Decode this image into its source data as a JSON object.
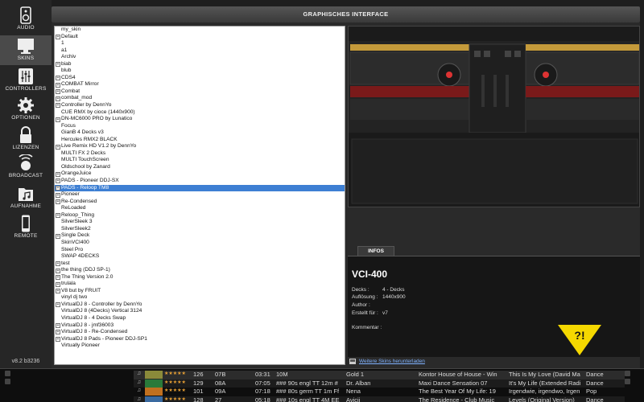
{
  "window": {
    "title": "GRAPHISCHES INTERFACE",
    "version": "v8.2 b3236"
  },
  "nav": [
    {
      "id": "audio",
      "label": "AUDIO",
      "icon": "speaker-icon"
    },
    {
      "id": "skins",
      "label": "SKINS",
      "icon": "monitor-icon",
      "active": true
    },
    {
      "id": "controllers",
      "label": "CONTROLLERS",
      "icon": "sliders-icon"
    },
    {
      "id": "optionen",
      "label": "OPTIONEN",
      "icon": "gear-icon"
    },
    {
      "id": "lizenzen",
      "label": "LIZENZEN",
      "icon": "lock-icon"
    },
    {
      "id": "broadcast",
      "label": "BROADCAST",
      "icon": "broadcast-icon"
    },
    {
      "id": "aufnahme",
      "label": "AUFNAHME",
      "icon": "music-folder-icon"
    },
    {
      "id": "remote",
      "label": "REMOTE",
      "icon": "phone-icon"
    }
  ],
  "skins": [
    {
      "name": "my_skin",
      "expand": false
    },
    {
      "name": "Default",
      "expand": true
    },
    {
      "name": "1",
      "expand": false
    },
    {
      "name": "a1",
      "expand": false
    },
    {
      "name": "Archiv",
      "expand": false
    },
    {
      "name": "biab",
      "expand": true
    },
    {
      "name": "blub",
      "expand": false
    },
    {
      "name": "CDS4",
      "expand": true
    },
    {
      "name": "COMBAT Mirror",
      "expand": true
    },
    {
      "name": "Combat",
      "expand": true
    },
    {
      "name": "combat_mod",
      "expand": true
    },
    {
      "name": "Controller by DennYo",
      "expand": true
    },
    {
      "name": "CUE RMX by cioce (1440x900)",
      "expand": false
    },
    {
      "name": "DN-MC6000 PRO by Lunatico",
      "expand": true
    },
    {
      "name": "Focus",
      "expand": false
    },
    {
      "name": "GianB 4 Decks v3",
      "expand": false
    },
    {
      "name": "Hercules RMX2 BLACK",
      "expand": false
    },
    {
      "name": "Live Remix HD V1.2 by DennYo",
      "expand": true
    },
    {
      "name": "MULTI FX 2 Decks",
      "expand": false
    },
    {
      "name": "MULTI TouchScreen",
      "expand": false
    },
    {
      "name": "Oldschool by Zanard",
      "expand": false
    },
    {
      "name": "OrangeJuice",
      "expand": true
    },
    {
      "name": "PADS - Pioneer DDJ-SX",
      "expand": true
    },
    {
      "name": "PADS - Reloop TM8",
      "expand": true,
      "selected": true
    },
    {
      "name": "Pioneer",
      "expand": true
    },
    {
      "name": "Re-Condensed",
      "expand": true
    },
    {
      "name": "ReLoaded",
      "expand": false
    },
    {
      "name": "Reloop_Thing",
      "expand": true
    },
    {
      "name": "SilverSleek 3",
      "expand": false
    },
    {
      "name": "SilverSleek2",
      "expand": false
    },
    {
      "name": "Single Deck",
      "expand": true
    },
    {
      "name": "SkinVCI400",
      "expand": false
    },
    {
      "name": "Steel Pro",
      "expand": false
    },
    {
      "name": "SWAP 4DECKS",
      "expand": false
    },
    {
      "name": "test",
      "expand": true
    },
    {
      "name": "the thing (DDJ SP-1)",
      "expand": true
    },
    {
      "name": "The Thing Version 2.0",
      "expand": true
    },
    {
      "name": "trulala",
      "expand": true
    },
    {
      "name": "V8 but by FRUIT",
      "expand": true
    },
    {
      "name": "vinyl dj two",
      "expand": false
    },
    {
      "name": "VirtualDJ 8 - Controller by DennYo",
      "expand": true
    },
    {
      "name": "VirtualDJ 8 (4Decks) Vertical 3124",
      "expand": false
    },
    {
      "name": "VirtualDJ 8 - 4 Decks Swap",
      "expand": false
    },
    {
      "name": "VirtualDJ 8 - jmf36003",
      "expand": true
    },
    {
      "name": "VirtualDJ 8 - Re-Condensed",
      "expand": true
    },
    {
      "name": "VirtualDJ 8 Pads - Pioneer DDJ-SP1",
      "expand": true
    },
    {
      "name": "Virtually Pioneer",
      "expand": false
    }
  ],
  "info": {
    "tab": "INFOS",
    "name": "VCI-400",
    "rows": [
      {
        "key": "Decks :",
        "value": "4 - Decks"
      },
      {
        "key": "Auflösung :",
        "value": "1440x900"
      },
      {
        "key": "Author :",
        "value": ""
      },
      {
        "key": "Erstellt für :",
        "value": "v7"
      },
      {
        "key": "Kommentar :",
        "value": ""
      }
    ],
    "warning": "?!",
    "download_link": "Weitere Skins herunterladen"
  },
  "tracks": [
    {
      "bpm": "126",
      "key": "07B",
      "len": "03:31",
      "title": "10M",
      "artist": "Gold 1",
      "album": "Kontor House of House - Win",
      "song": "This Is My Love (David Ma",
      "genre": "Dance"
    },
    {
      "bpm": "129",
      "key": "08A",
      "len": "07:05",
      "title": "### 90s engl TT 12m #",
      "artist": "Dr. Alban",
      "album": "Maxi Dance Sensation 07",
      "song": "It's My Life (Extended Radi",
      "genre": "Dance"
    },
    {
      "bpm": "101",
      "key": "09A",
      "len": "07:18",
      "title": "### 80s germ TT 1m Ff",
      "artist": "Nena",
      "album": "The Best Year Of My Life: 19",
      "song": "Irgendwie, irgendwo, Irgen",
      "genre": "Pop"
    },
    {
      "bpm": "128",
      "key": "27",
      "len": "05:18",
      "title": "### 10s engl TT 4M EE",
      "artist": "Avicii",
      "album": "The Residence - Club Music",
      "song": "Levels (Original Version)",
      "genre": "Dance"
    }
  ],
  "colors": {
    "accent": "#3d7fd3",
    "warning": "#f5d800",
    "star": "#e8a034"
  }
}
